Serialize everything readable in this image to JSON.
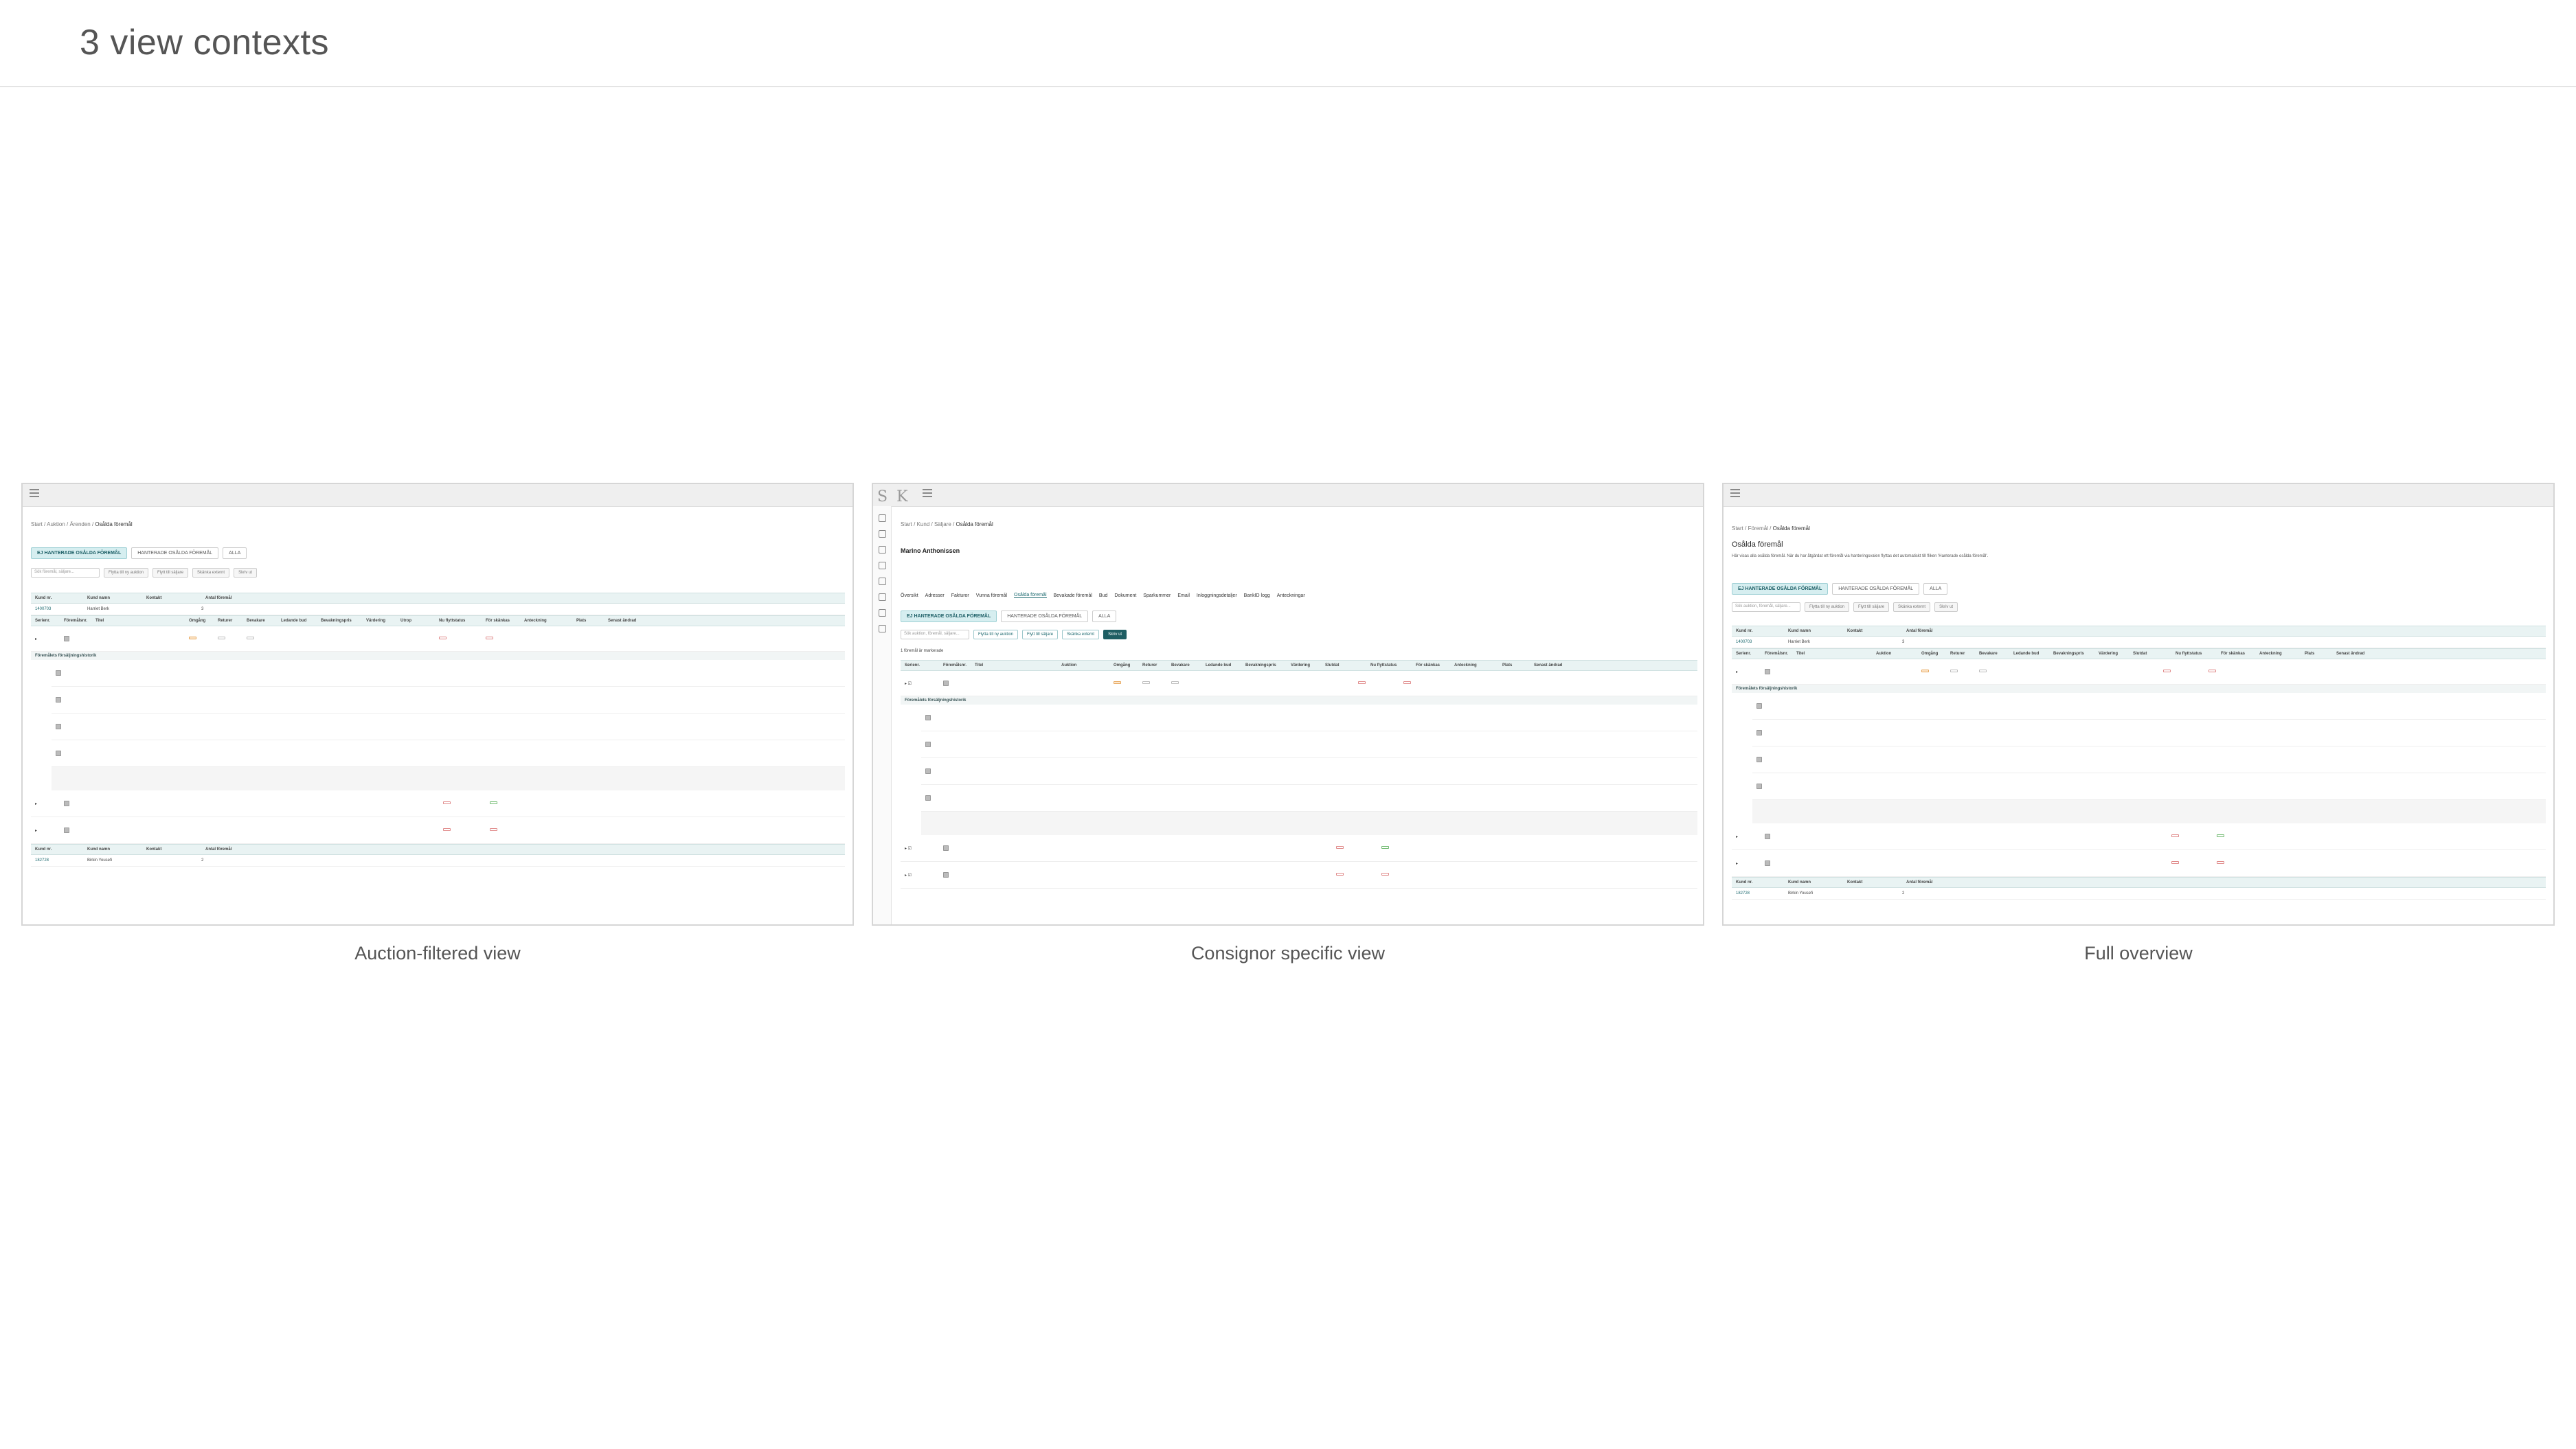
{
  "page": {
    "title": "3 view contexts"
  },
  "panels": [
    {
      "caption": "Auction-filtered view",
      "breadcrumbs": [
        "Start",
        "Auktion",
        "Ärenden",
        "Osålda föremål"
      ],
      "tabs": [
        "EJ HANTERADE OSÅLDA FÖREMÅL",
        "HANTERADE OSÅLDA FÖREMÅL",
        "ALLA"
      ],
      "search_placeholder": "Sök föremål, säljare...",
      "buttons": [
        "Flytta till ny auktion",
        "Flytt till säljare",
        "Skänka externt",
        "Skriv ut"
      ],
      "customer_header": [
        "Kund nr.",
        "Kund namn",
        "Kontakt",
        "Antal föremål"
      ],
      "customer_row": [
        "1400703",
        "Harriet Berk",
        "3"
      ],
      "columns": [
        "Serienr.",
        "Föremålsnr.",
        "Titel",
        "Omgång",
        "Returer",
        "Bevakare",
        "Ledande bud",
        "Bevakningspris",
        "Värdering",
        "Utrop",
        "Nu flyttstatus",
        "För skänkas",
        "Anteckning",
        "Plats",
        "Senast ändrad"
      ],
      "subheader": "Föremålets försäljningshistorik",
      "customer2_row": [
        "182728",
        "Birkin Yousefi",
        "2"
      ]
    },
    {
      "caption": "Consignor specific view",
      "breadcrumbs": [
        "Start",
        "Kund",
        "Säljare",
        "Osålda föremål"
      ],
      "profile_name": "Marino Anthonissen",
      "profile_tabs": [
        "Översikt",
        "Adresser",
        "Fakturor",
        "Vunna föremål",
        "Osålda föremål",
        "Bevakade föremål",
        "Bud",
        "Dokument",
        "Sparkummer",
        "Email",
        "Inloggningsdetaljer",
        "BankID logg",
        "Anteckningar"
      ],
      "tabs": [
        "EJ HANTERADE OSÅLDA FÖREMÅL",
        "HANTERADE OSÅLDA FÖREMÅL",
        "ALLA"
      ],
      "search_placeholder": "Sök auktion, föremål, säljare...",
      "buttons": [
        "Flytta till ny auktion",
        "Flytt till säljare",
        "Skänka externt",
        "Skriv ut"
      ],
      "selected_info": "1 föremål är markerade",
      "columns": [
        "Serienr.",
        "Föremålsnr.",
        "Titel",
        "Auktion",
        "Omgång",
        "Returer",
        "Bevakare",
        "Ledande bud",
        "Bevakningspris",
        "Värdering",
        "Slutdat",
        "Nu flyttstatus",
        "För skänkas",
        "Anteckning",
        "Plats",
        "Senast ändrad"
      ],
      "subheader": "Föremålets försäljningshistorik"
    },
    {
      "caption": "Full overview",
      "breadcrumbs": [
        "Start",
        "Föremål",
        "Osålda föremål"
      ],
      "heading": "Osålda föremål",
      "description": "Här visas alla osålda föremål. När du har åtgärdat ett föremål via hanteringsvalen flyttas det automatiskt till fliken 'Hanterade osålda föremål'.",
      "tabs": [
        "EJ HANTERADE OSÅLDA FÖREMÅL",
        "HANTERADE OSÅLDA FÖREMÅL",
        "ALLA"
      ],
      "search_placeholder": "Sök auktion, föremål, säljare...",
      "buttons": [
        "Flytta till ny auktion",
        "Flytt till säljare",
        "Skänka externt",
        "Skriv ut"
      ],
      "customer_header": [
        "Kund nr.",
        "Kund namn",
        "Kontakt",
        "Antal föremål"
      ],
      "customer_row": [
        "1400703",
        "Harriet Berk",
        "3"
      ],
      "columns": [
        "Serienr.",
        "Föremålsnr.",
        "Titel",
        "Auktion",
        "Omgång",
        "Returer",
        "Bevakare",
        "Ledande bud",
        "Bevakningspris",
        "Värdering",
        "Slutdat",
        "Nu flyttstatus",
        "För skänkas",
        "Anteckning",
        "Plats",
        "Senast ändrad"
      ],
      "subheader": "Föremålets försäljningshistorik",
      "customer2_row": [
        "182728",
        "Birkin Yousefi",
        "2"
      ]
    }
  ]
}
